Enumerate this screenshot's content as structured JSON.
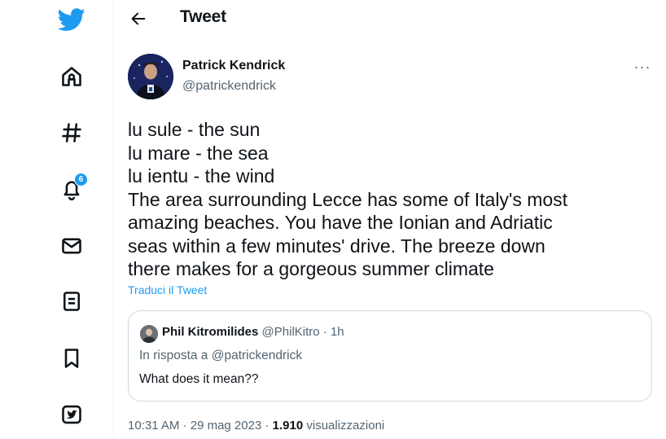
{
  "sidebar": {
    "notification_badge": "6",
    "items": [
      {
        "icon": "twitter-bird-icon"
      },
      {
        "icon": "home-icon"
      },
      {
        "icon": "hashtag-icon"
      },
      {
        "icon": "bell-icon"
      },
      {
        "icon": "envelope-icon"
      },
      {
        "icon": "list-icon"
      },
      {
        "icon": "bookmark-icon"
      },
      {
        "icon": "twitter-blue-icon"
      }
    ]
  },
  "header": {
    "title": "Tweet",
    "back_icon": "arrow-left-icon"
  },
  "tweet": {
    "author_name": "Patrick Kendrick",
    "author_handle": "@patrickendrick",
    "more_label": "···",
    "lines": [
      "lu sule - the sun",
      "lu mare - the sea",
      "lu ientu - the wind",
      "The area surrounding Lecce has some of Italy's most",
      "amazing beaches. You have the Ionian and Adriatic",
      "seas within a few minutes' drive. The breeze down",
      "there makes for a gorgeous summer climate"
    ],
    "translate_label": "Traduci il Tweet",
    "time": "10:31 AM",
    "date": "29 mag 2023",
    "views_count": "1.910",
    "views_label": "visualizzazioni",
    "separator": " · "
  },
  "quote": {
    "author_name": "Phil Kitromilides",
    "author_handle": "@PhilKitro",
    "time": "1h",
    "reply_to": "In risposta a @patrickendrick",
    "text": "What does it mean??"
  },
  "colors": {
    "accent": "#1d9bf0",
    "text": "#0f1419",
    "muted": "#536471",
    "border": "#cfd9de"
  }
}
